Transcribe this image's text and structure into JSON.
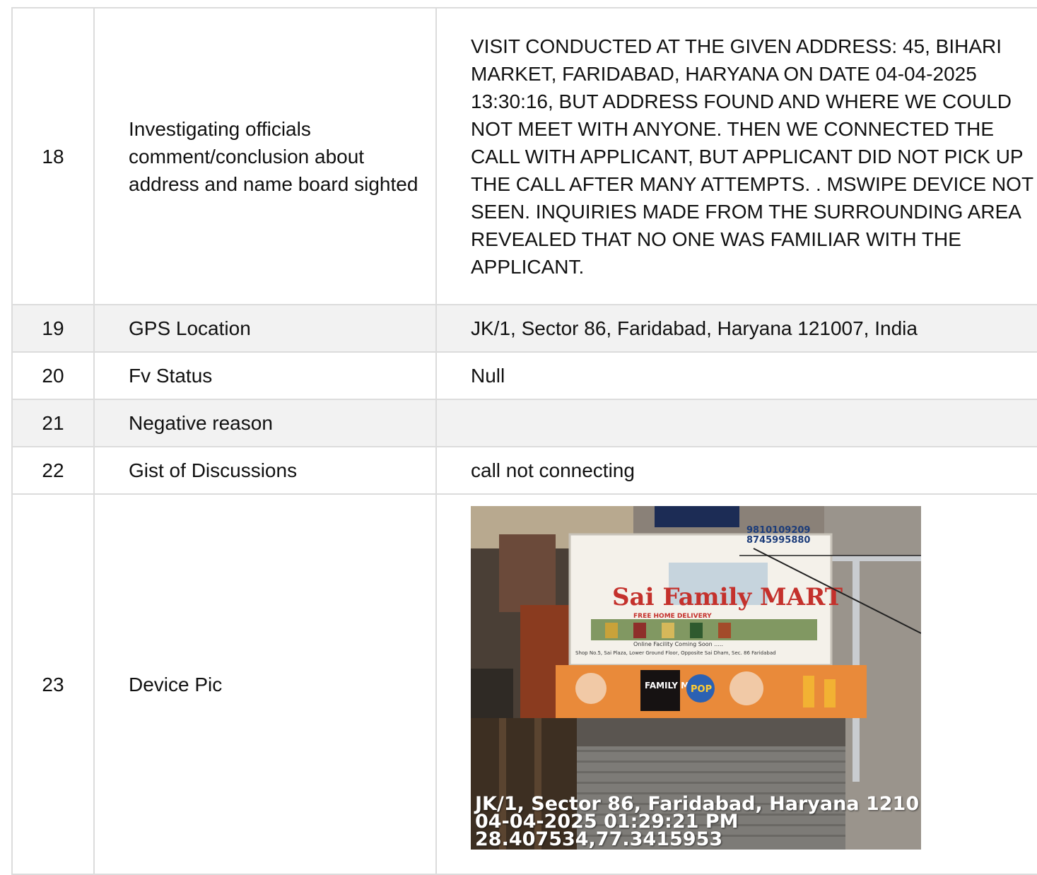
{
  "rows": [
    {
      "num": "18",
      "label": "Investigating officials comment/conclusion about address and name board sighted",
      "value": "VISIT CONDUCTED AT THE GIVEN ADDRESS: 45, BIHARI MARKET, FARIDABAD, HARYANA ON DATE 04-04-2025 13:30:16, BUT ADDRESS FOUND AND WHERE WE COULD NOT MEET WITH ANYONE. THEN WE CONNECTED THE CALL WITH APPLICANT, BUT APPLICANT DID NOT PICK UP THE CALL AFTER MANY ATTEMPTS. . MSWIPE DEVICE NOT SEEN. INQUIRIES MADE FROM THE SURROUNDING AREA REVEALED THAT NO ONE WAS FAMILIAR WITH THE APPLICANT."
    },
    {
      "num": "19",
      "label": "GPS Location",
      "value": "JK/1, Sector 86, Faridabad, Haryana 121007, India"
    },
    {
      "num": "20",
      "label": "Fv Status",
      "value": "Null"
    },
    {
      "num": "21",
      "label": "Negative reason",
      "value": ""
    },
    {
      "num": "22",
      "label": "Gist of Discussions",
      "value": "call not connecting"
    },
    {
      "num": "23",
      "label": "Device Pic",
      "value": ""
    }
  ],
  "photo": {
    "overlay_line1": "JK/1, Sector 86, Faridabad, Haryana 1210",
    "overlay_line2": "04-04-2025 01:29:21 PM",
    "overlay_line3": "28.407534,77.3415953",
    "sign_brand": "Sai Family MART",
    "sign_phone1": "9810109209",
    "sign_phone2": "8745995880",
    "sign_delivery": "FREE HOME DELIVERY",
    "sign_online": "Online Facility Coming Soon .....",
    "sign_address": "Shop No.5, Sai Plaza, Lower Ground Floor, Opposite Sai Dham, Sec. 86 Faridabad",
    "banner_text": "FAMILY MART",
    "banner_pop": "POP"
  }
}
